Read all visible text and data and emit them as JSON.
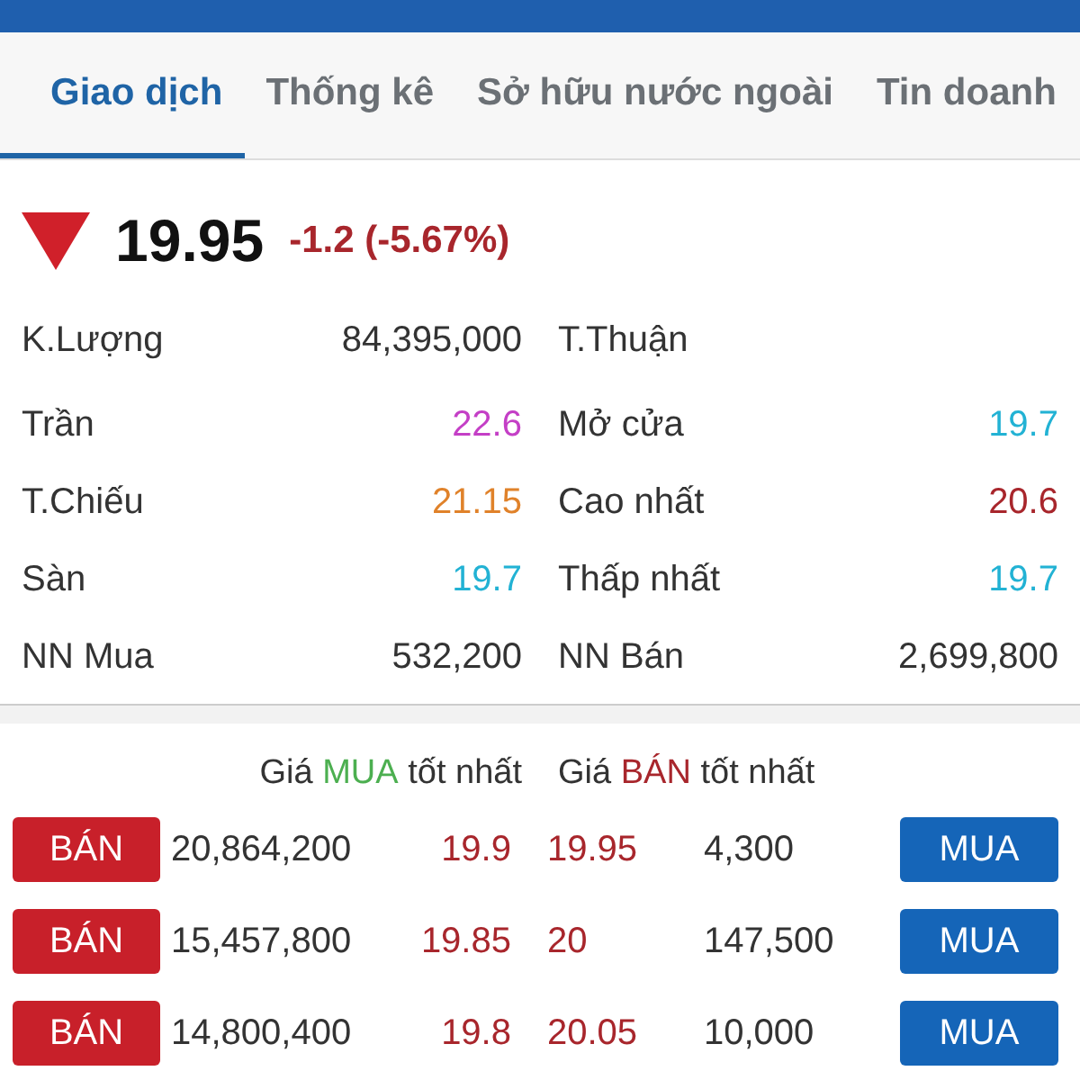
{
  "tabs": [
    {
      "label": "Giao dịch",
      "selected": true
    },
    {
      "label": "Thống kê",
      "selected": false
    },
    {
      "label": "Sở hữu nước ngoài",
      "selected": false
    },
    {
      "label": "Tin doanh",
      "selected": false
    }
  ],
  "quote": {
    "kind": "down",
    "price": "19.95",
    "change": "-1.2 (-5.67%)"
  },
  "stats": [
    {
      "label": "K.Lượng",
      "value": "84,395,000"
    },
    {
      "label": "T.Thuận"
    },
    {
      "label": "Trần",
      "value": "22.6",
      "color": "#c43fc6"
    },
    {
      "label": "Mở cửa",
      "value": "19.7",
      "color": "#22b2d4"
    },
    {
      "label": "T.Chiếu",
      "value": "21.15",
      "color": "#e0822a"
    },
    {
      "label": "Cao nhất",
      "value": "20.6",
      "color": "#a8262c"
    },
    {
      "label": "Sàn",
      "value": "19.7",
      "color": "#22b2d4"
    },
    {
      "label": "Thấp nhất",
      "value": "19.7",
      "color": "#22b2d4"
    },
    {
      "label": "NN Mua",
      "value": "532,200"
    },
    {
      "label": "NN Bán",
      "value": "2,699,800"
    }
  ],
  "best_bid_heading": {
    "before": "Giá",
    "highlight": "MUA",
    "after": "tốt nhất",
    "color": "#4caf50"
  },
  "best_ask_heading": {
    "before": "Giá",
    "highlight": "BÁN",
    "after": "tốt nhất",
    "color": "#a8262c"
  },
  "orders": [
    {
      "sell_button": "BÁN",
      "bid_volume": "20,864,200",
      "bid_price": "19.9",
      "ask_price": "19.95",
      "ask_volume": "4,300",
      "buy_button": "MUA"
    },
    {
      "sell_button": "BÁN",
      "bid_volume": "15,457,800",
      "bid_price": "19.85",
      "ask_price": "20",
      "ask_volume": "147,500",
      "buy_button": "MUA"
    },
    {
      "sell_button": "BÁN",
      "bid_volume": "14,800,400",
      "bid_price": "19.8",
      "ask_price": "20.05",
      "ask_volume": "10,000",
      "buy_button": "MUA"
    }
  ]
}
